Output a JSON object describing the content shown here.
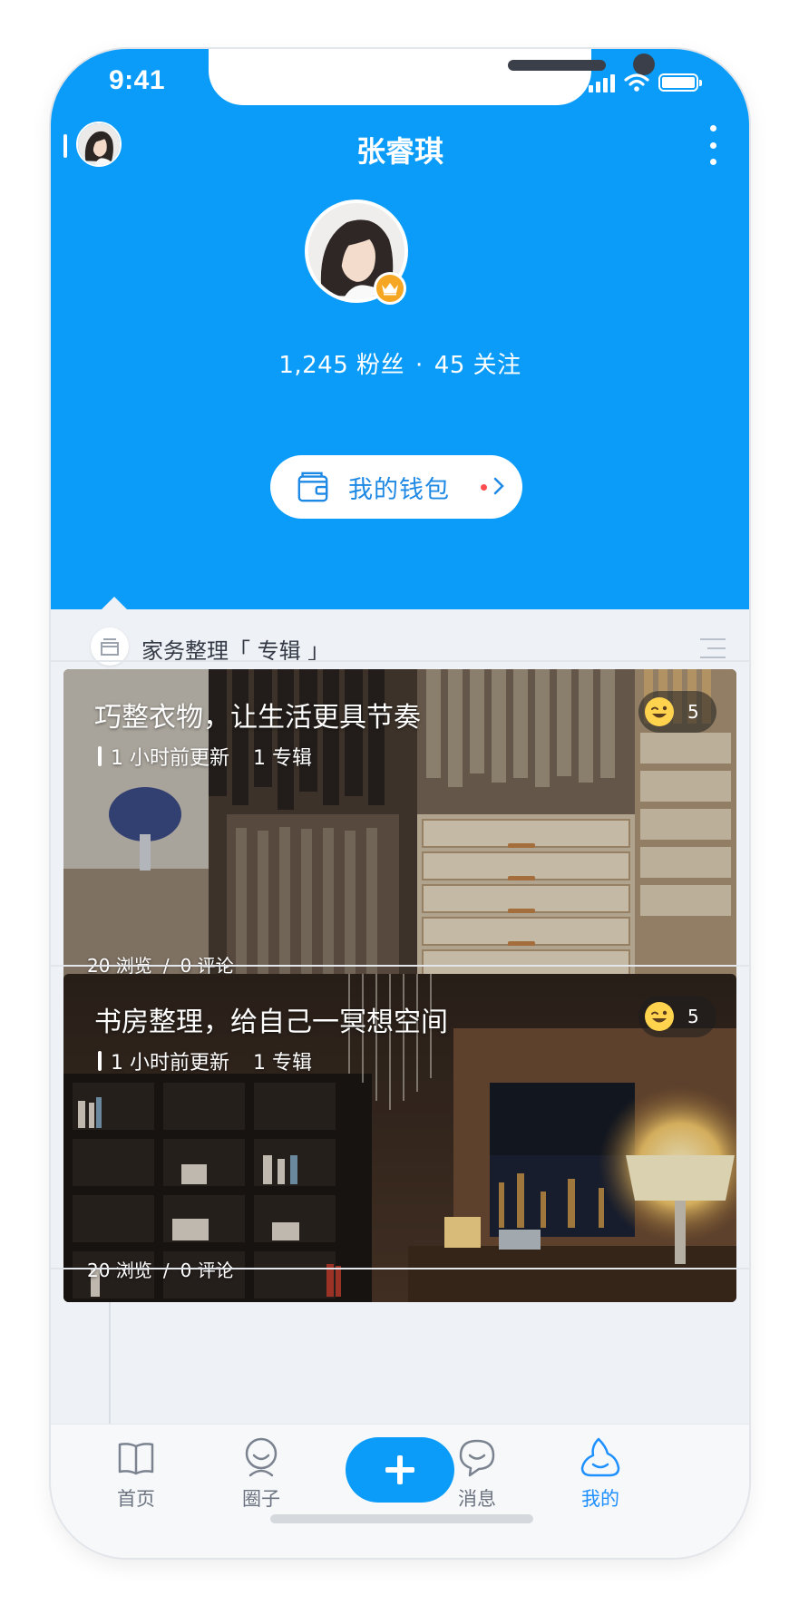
{
  "status_bar": {
    "time": "9:41"
  },
  "nav": {
    "title": "张睿琪"
  },
  "profile": {
    "followers_text": "1,245 粉丝",
    "dot": "·",
    "following_text": "45 关注",
    "wallet_label": "我的钱包"
  },
  "album": {
    "title": "家务整理「 专辑 」"
  },
  "cards": [
    {
      "title": "巧整衣物，让生活更具节奏",
      "updated": "1 小时前更新",
      "albums": "1 专辑",
      "likes": "5",
      "views": "20 浏览",
      "slash": "/",
      "comments": "0 评论"
    },
    {
      "title": "书房整理，给自己一冥想空间",
      "updated": "1 小时前更新",
      "albums": "1 专辑",
      "likes": "5",
      "views": "20 浏览",
      "slash": "/",
      "comments": "0 评论"
    }
  ],
  "tabbar": {
    "tabs": [
      {
        "label": "首页",
        "icon": "book-icon"
      },
      {
        "label": "圈子",
        "icon": "circle-user-icon"
      },
      {
        "label": "消息",
        "icon": "chat-bubble-icon"
      },
      {
        "label": "我的",
        "icon": "profile-drop-icon"
      }
    ],
    "add_icon": "plus-icon"
  },
  "colors": {
    "primary": "#0A9CF8",
    "active_tab": "#1E90FF",
    "badge": "#F5A623",
    "notification_dot": "#FF4D4F"
  }
}
